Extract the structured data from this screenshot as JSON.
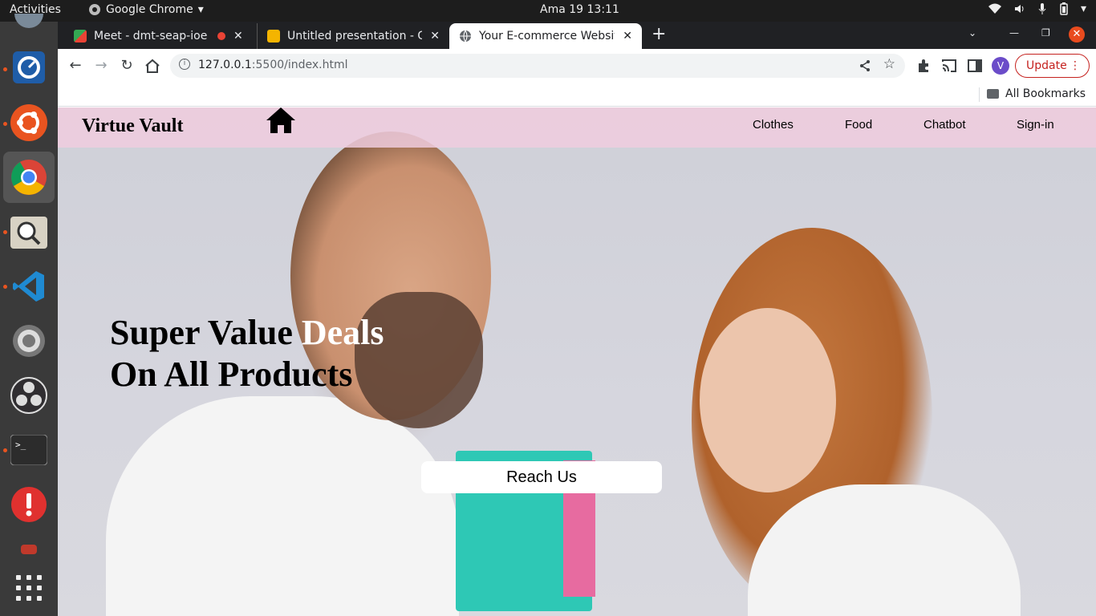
{
  "os": {
    "activities": "Activities",
    "app_name": "Google Chrome",
    "clock": "Ama 19  13:11"
  },
  "browser": {
    "tabs": [
      {
        "title": "Meet - dmt-seap-ioe",
        "favicon_color": "#34a853"
      },
      {
        "title": "Untitled presentation - Go",
        "favicon_color": "#f4b400"
      },
      {
        "title": "Your E-commerce Websit",
        "favicon_color": "#5f6368"
      }
    ],
    "url_host": "127.0.0.1",
    "url_path": ":5500/index.html",
    "avatar_letter": "V",
    "update_label": "Update",
    "bookmarks_label": "All Bookmarks"
  },
  "site": {
    "brand": "Virtue Vault",
    "nav": [
      "Clothes",
      "Food",
      "Chatbot",
      "Sign-in"
    ],
    "hero_line1_a": "Super Value ",
    "hero_line1_b": "Deals",
    "hero_line2": "On All Products",
    "cta_label": "Reach Us",
    "nav_bg": "#f0cdde"
  }
}
